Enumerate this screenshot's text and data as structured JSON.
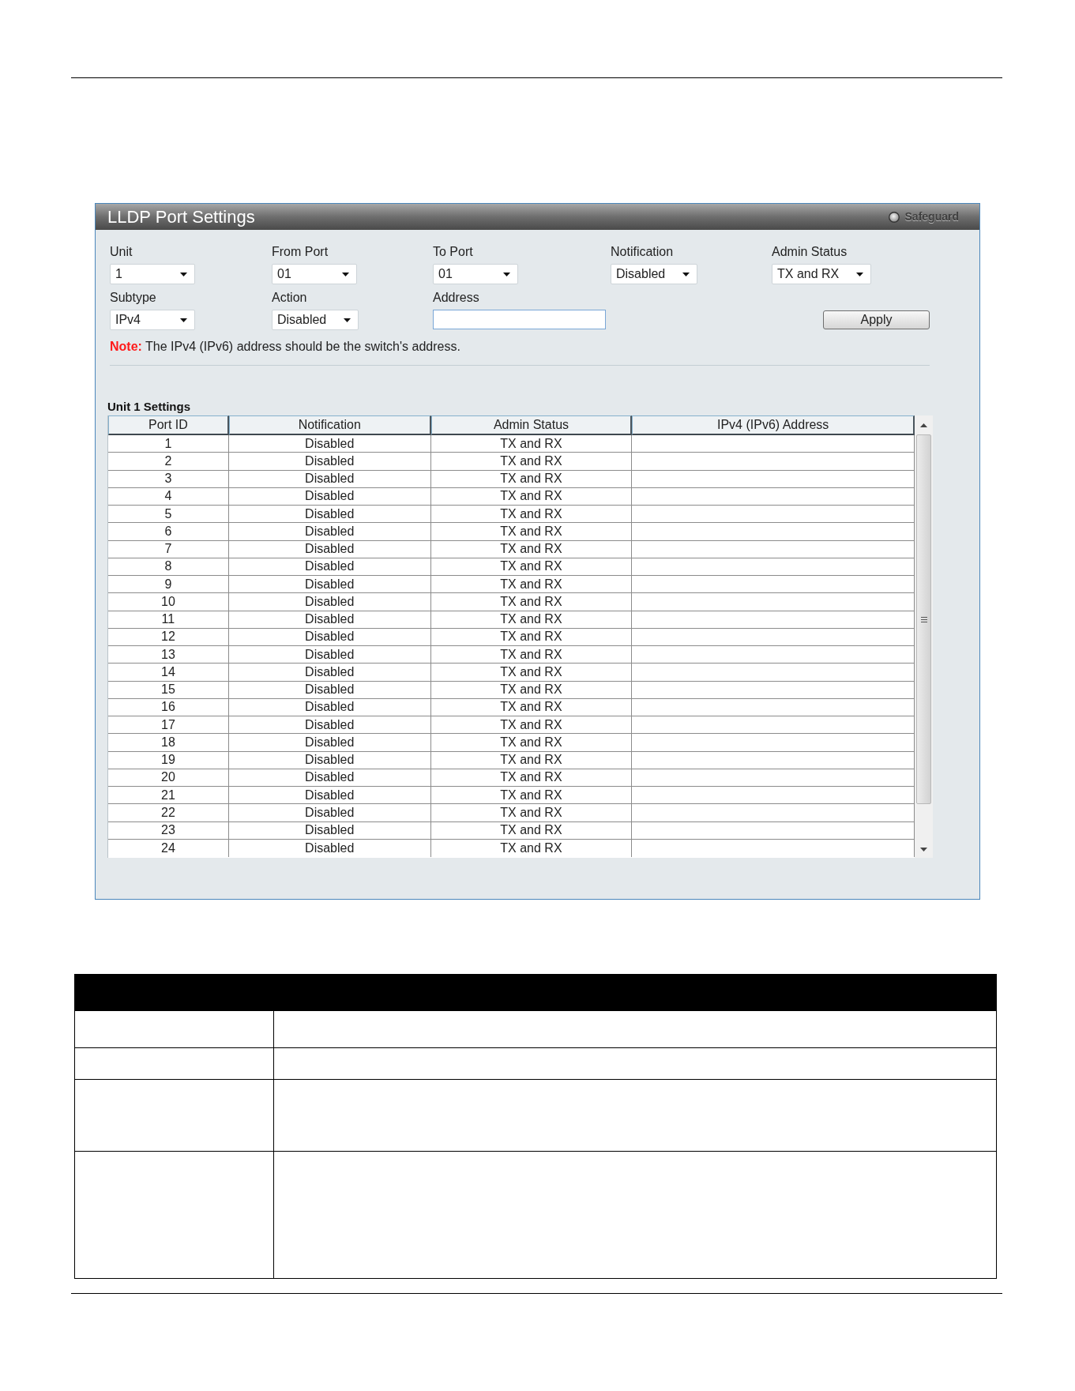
{
  "panel": {
    "title": "LLDP Port Settings",
    "badge": "Safeguard"
  },
  "form": {
    "fields": [
      {
        "kind": "select",
        "label": "Unit",
        "value": "1"
      },
      {
        "kind": "select",
        "label": "From Port",
        "value": "01"
      },
      {
        "kind": "select",
        "label": "To Port",
        "value": "01"
      },
      {
        "kind": "select",
        "label": "Notification",
        "value": "Disabled"
      },
      {
        "kind": "select",
        "label": "Admin Status",
        "value": "TX and RX"
      },
      {
        "kind": "select",
        "label": "Subtype",
        "value": "IPv4"
      },
      {
        "kind": "select",
        "label": "Action",
        "value": "Disabled"
      },
      {
        "kind": "input",
        "label": "Address"
      }
    ],
    "apply_button": "Apply",
    "note": "**Note:** The IPv4 (IPv6) address should be the switch's address."
  },
  "table": {
    "title": "Unit 1 Settings",
    "columns": [
      "Port ID",
      "Notification",
      "Admin Status",
      "IPv4 (IPv6) Address"
    ],
    "rows": [
      {
        "port_id": "1",
        "notification": "Disabled",
        "admin_status": "TX and RX"
      },
      {
        "port_id": "2",
        "notification": "Disabled",
        "admin_status": "TX and RX"
      },
      {
        "port_id": "3",
        "notification": "Disabled",
        "admin_status": "TX and RX"
      },
      {
        "port_id": "4",
        "notification": "Disabled",
        "admin_status": "TX and RX"
      },
      {
        "port_id": "5",
        "notification": "Disabled",
        "admin_status": "TX and RX"
      },
      {
        "port_id": "6",
        "notification": "Disabled",
        "admin_status": "TX and RX"
      },
      {
        "port_id": "7",
        "notification": "Disabled",
        "admin_status": "TX and RX"
      },
      {
        "port_id": "8",
        "notification": "Disabled",
        "admin_status": "TX and RX"
      },
      {
        "port_id": "9",
        "notification": "Disabled",
        "admin_status": "TX and RX"
      },
      {
        "port_id": "10",
        "notification": "Disabled",
        "admin_status": "TX and RX"
      },
      {
        "port_id": "11",
        "notification": "Disabled",
        "admin_status": "TX and RX"
      },
      {
        "port_id": "12",
        "notification": "Disabled",
        "admin_status": "TX and RX"
      },
      {
        "port_id": "13",
        "notification": "Disabled",
        "admin_status": "TX and RX"
      },
      {
        "port_id": "14",
        "notification": "Disabled",
        "admin_status": "TX and RX"
      },
      {
        "port_id": "15",
        "notification": "Disabled",
        "admin_status": "TX and RX"
      },
      {
        "port_id": "16",
        "notification": "Disabled",
        "admin_status": "TX and RX"
      },
      {
        "port_id": "17",
        "notification": "Disabled",
        "admin_status": "TX and RX"
      },
      {
        "port_id": "18",
        "notification": "Disabled",
        "admin_status": "TX and RX"
      },
      {
        "port_id": "19",
        "notification": "Disabled",
        "admin_status": "TX and RX"
      },
      {
        "port_id": "20",
        "notification": "Disabled",
        "admin_status": "TX and RX"
      },
      {
        "port_id": "21",
        "notification": "Disabled",
        "admin_status": "TX and RX"
      },
      {
        "port_id": "22",
        "notification": "Disabled",
        "admin_status": "TX and RX"
      },
      {
        "port_id": "23",
        "notification": "Disabled",
        "admin_status": "TX and RX"
      },
      {
        "port_id": "24",
        "notification": "Disabled",
        "admin_status": "TX and RX"
      }
    ]
  }
}
